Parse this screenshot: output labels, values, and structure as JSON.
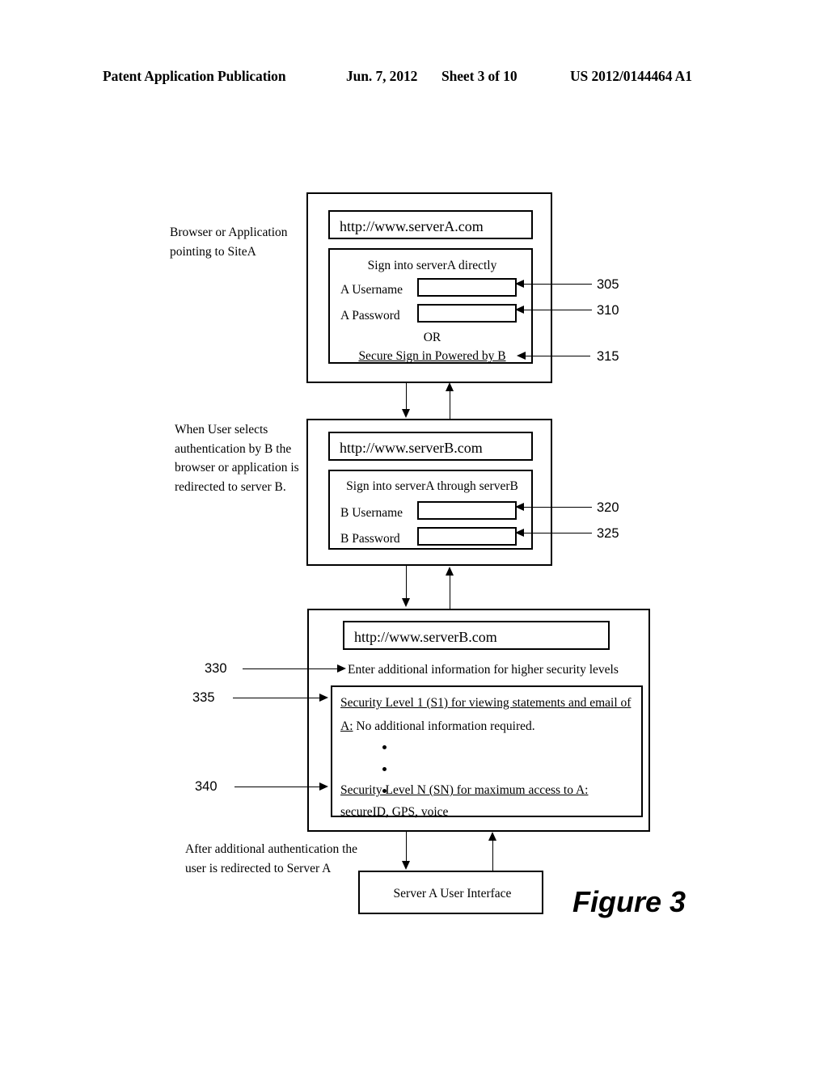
{
  "header": {
    "publication": "Patent Application Publication",
    "date": "Jun. 7, 2012",
    "sheet": "Sheet 3 of 10",
    "doc_number": "US 2012/0144464 A1"
  },
  "figure": {
    "label": "Figure 3"
  },
  "captions": {
    "top": "Browser or Application pointing to SiteA",
    "middle": "When User selects authentication by B the browser or application is redirected to server B.",
    "bottom": "After additional authentication the user is redirected to Server A"
  },
  "panel_a": {
    "url": "http://www.serverA.com",
    "form_title": "Sign into serverA directly",
    "username_label": "A Username",
    "username_value": "",
    "password_label": "A Password",
    "password_value": "",
    "or_label": "OR",
    "federated_link": "Secure Sign in Powered by B"
  },
  "panel_b": {
    "url": "http://www.serverB.com",
    "form_title": "Sign into serverA through serverB",
    "username_label": "B Username",
    "username_value": "",
    "password_label": "B Password",
    "password_value": ""
  },
  "panel_c": {
    "url": "http://www.serverB.com",
    "prompt": "Enter additional information for higher security levels",
    "level1_heading": "Security Level 1 (S1) for viewing statements and email of",
    "level1_heading_cont": "A:",
    "level1_body": "No additional information required.",
    "levelN_heading": "Security Level N (SN) for maximum access to A:",
    "levelN_body": "secureID, GPS, voice",
    "bullets": [
      "",
      "",
      ""
    ]
  },
  "server_a_ui": {
    "label": "Server A User Interface"
  },
  "reference_numerals": {
    "n305": "305",
    "n310": "310",
    "n315": "315",
    "n320": "320",
    "n325": "325",
    "n330": "330",
    "n335": "335",
    "n340": "340"
  }
}
